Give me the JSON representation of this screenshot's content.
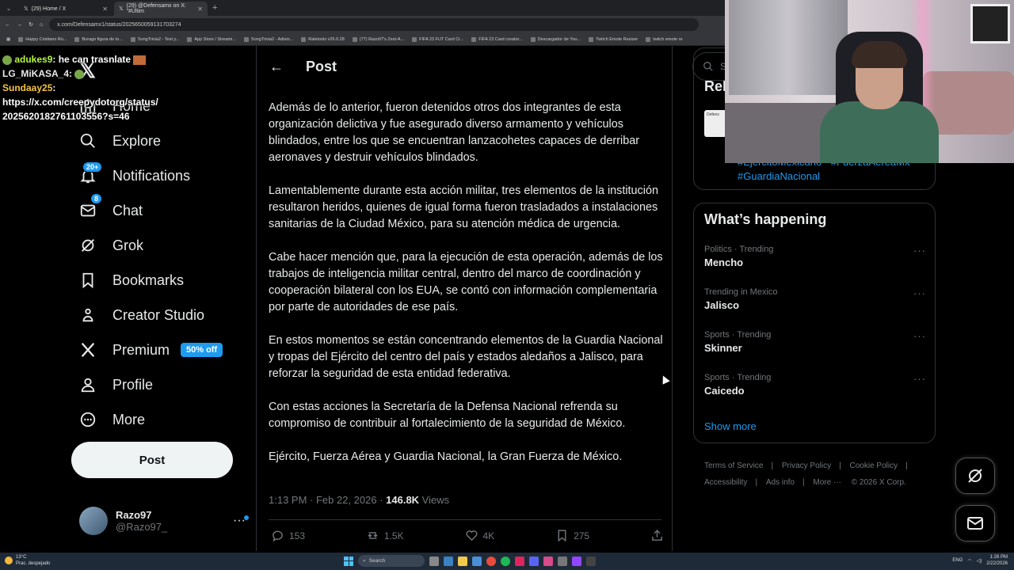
{
  "browser": {
    "tabs": [
      {
        "label": "(29) Home / X",
        "active": false
      },
      {
        "label": "(29) @Defensamx on X: \"#Últim",
        "active": true
      }
    ],
    "url": "x.com/Defensamx1/status/2025650059131703274",
    "bookmarks": [
      "Happy Cristiano Ro...",
      "Burago figura de to...",
      "SongTrivia2 - Test y...",
      "App Store / Streami...",
      "SongTrivia2 - Adivin...",
      "Raletools v26.0.28",
      "(77) Razo97's Zest-A...",
      "FIFA 23 FUT Card Cr...",
      "FIFA 23 Card creator...",
      "Descargador de You...",
      "Twitch Emote Resizer",
      "twitch emote re"
    ]
  },
  "chat": {
    "messages": [
      {
        "user": "adukes9",
        "text": ": he can trasnlate"
      },
      {
        "user": "LG_MiKASA_4",
        "text": ":"
      },
      {
        "user": "Sundaay25",
        "text": ":"
      },
      {
        "user": "",
        "text": "https://x.com/creepydotorg/status/"
      },
      {
        "user": "",
        "text": "2025620182761103556?s=46"
      }
    ]
  },
  "nav": {
    "home": "Home",
    "explore": "Explore",
    "notifications": "Notifications",
    "notifications_badge": "20+",
    "chat": "Chat",
    "chat_badge": "8",
    "grok": "Grok",
    "bookmarks": "Bookmarks",
    "creator_studio": "Creator Studio",
    "premium": "Premium",
    "premium_tag": "50% off",
    "profile": "Profile",
    "more": "More",
    "post_button": "Post"
  },
  "account": {
    "name": "Razo97",
    "handle": "@Razo97_"
  },
  "main": {
    "title": "Post",
    "paragraphs": [
      "Además de lo anterior, fueron detenidos otros dos integrantes de esta organización delictiva y fue asegurado diverso armamento y vehículos blindados, entre los que se encuentran lanzacohetes capaces de derribar aeronaves y destruir vehículos blindados.",
      "Lamentablemente durante esta acción militar, tres elementos de la institución resultaron heridos, quienes de igual forma fueron trasladados a instalaciones sanitarias de la Ciudad México, para su atención médica de urgencia.",
      "Cabe hacer mención que, para la ejecución de esta operación, además de los trabajos de inteligencia militar central, dentro del marco de coordinación y cooperación bilateral con los EUA, se contó con información complementaria por parte de autoridades de ese país.",
      "En estos momentos se están concentrando elementos de la Guardia Nacional y tropas del Ejército del centro del país y estados aledaños a Jalisco, para reforzar la seguridad de esta entidad federativa.",
      "Con estas acciones la Secretaría de la Defensa Nacional refrenda su compromiso de contribuir al fortalecimiento de la seguridad de México.",
      "Ejército, Fuerza Aérea y Guardia Nacional, la Gran Fuerza de México."
    ],
    "timestamp": "1:13 PM · Feb 22, 2026 · ",
    "views_count": "146.8K",
    "views_label": " Views",
    "replies": "153",
    "reposts": "1.5K",
    "likes": "4K",
    "bookmarks": "275"
  },
  "right": {
    "search_placeholder": "Se",
    "relevant_title": "Rel",
    "relevant_thumb": "Defens",
    "relevant_tags_line1": "#EjercitoMexicano · #FuerzaAereaMx",
    "relevant_tags_line2": "#GuardiaNacional",
    "happening_title": "What’s happening",
    "trends": [
      {
        "category": "Politics · Trending",
        "name": "Mencho"
      },
      {
        "category": "Trending in Mexico",
        "name": "Jalisco"
      },
      {
        "category": "Sports · Trending",
        "name": "Skinner"
      },
      {
        "category": "Sports · Trending",
        "name": "Caicedo"
      }
    ],
    "show_more": "Show more",
    "footer": [
      "Terms of Service",
      "Privacy Policy",
      "Cookie Policy",
      "Accessibility",
      "Ads info",
      "More ···",
      "© 2026 X Corp."
    ]
  },
  "taskbar": {
    "weather_temp": "13°C",
    "weather_desc": "Prac. despejado",
    "search": "Search",
    "lang": "ENG",
    "time": "1:26 PM",
    "date": "2/22/2026"
  },
  "colors": {
    "accent": "#1d9bf0",
    "background": "#000000",
    "text": "#e7e9ea",
    "muted": "#71767b",
    "border": "#2f3336"
  }
}
